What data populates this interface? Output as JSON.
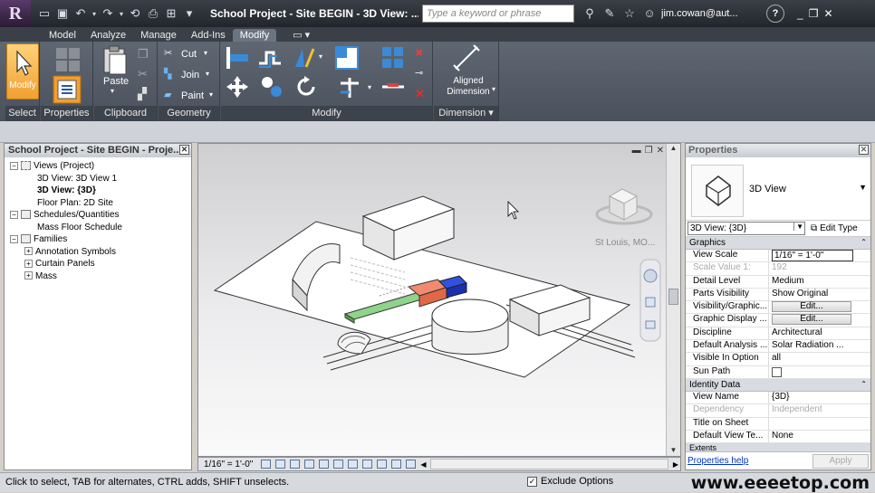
{
  "titlebar": {
    "app_letter": "R",
    "title": "School Project - Site BEGIN - 3D View: ...",
    "search_placeholder": "Type a keyword or phrase",
    "user": "jim.cowan@aut...",
    "help": "?"
  },
  "tabs": [
    "Model",
    "Analyze",
    "Manage",
    "Add-Ins",
    "Modify"
  ],
  "ribbon": {
    "modify_tool": "Modify",
    "paste": "Paste",
    "cut": "Cut",
    "join": "Join",
    "paint": "Paint",
    "aligned_dimension": "Aligned Dimension",
    "panels": [
      "Select",
      "Properties",
      "Clipboard",
      "Geometry",
      "Modify",
      "Dimension"
    ]
  },
  "browser": {
    "title": "School Project - Site BEGIN - Proje...",
    "items": [
      {
        "label": "Views (Project)",
        "level": 0,
        "expander": "−"
      },
      {
        "label": "3D View: 3D View 1",
        "level": 1
      },
      {
        "label": "3D View: {3D}",
        "level": 1,
        "bold": true
      },
      {
        "label": "Floor Plan: 2D Site",
        "level": 1
      },
      {
        "label": "Schedules/Quantities",
        "level": 0,
        "expander": "−"
      },
      {
        "label": "Mass Floor Schedule",
        "level": 1
      },
      {
        "label": "Families",
        "level": 0,
        "expander": "−"
      },
      {
        "label": "Annotation Symbols",
        "level": 1,
        "expander": "+"
      },
      {
        "label": "Curtain Panels",
        "level": 1,
        "expander": "+"
      },
      {
        "label": "Mass",
        "level": 1,
        "expander": "+"
      }
    ]
  },
  "viewport": {
    "location": "St Louis, MO...",
    "scale": "1/16\" = 1'-0\""
  },
  "properties": {
    "title": "Properties",
    "type_name": "3D View",
    "instance": "3D View: {3D}",
    "edit_type": "Edit Type",
    "groups": [
      {
        "name": "Graphics",
        "rows": [
          {
            "key": "View Scale",
            "value": "1/16\" = 1'-0\""
          },
          {
            "key": "Scale Value    1:",
            "value": "192",
            "disabled": true
          },
          {
            "key": "Detail Level",
            "value": "Medium"
          },
          {
            "key": "Parts Visibility",
            "value": "Show Original"
          },
          {
            "key": "Visibility/Graphic...",
            "value": "Edit..."
          },
          {
            "key": "Graphic Display ...",
            "value": "Edit..."
          },
          {
            "key": "Discipline",
            "value": "Architectural"
          },
          {
            "key": "Default Analysis ...",
            "value": "Solar Radiation ..."
          },
          {
            "key": "Visible In Option",
            "value": "all"
          },
          {
            "key": "Sun Path",
            "value": ""
          }
        ]
      },
      {
        "name": "Identity Data",
        "rows": [
          {
            "key": "View Name",
            "value": "{3D}"
          },
          {
            "key": "Dependency",
            "value": "Independent",
            "disabled": true
          },
          {
            "key": "Title on Sheet",
            "value": ""
          },
          {
            "key": "Default View Te...",
            "value": "None"
          }
        ]
      },
      {
        "name": "Extents",
        "rows": []
      }
    ],
    "help_link": "Properties help",
    "apply": "Apply"
  },
  "statusbar": {
    "text": "Click to select, TAB for alternates, CTRL adds, SHIFT unselects.",
    "exclude_options": "Exclude Options",
    "watermark": "www.eeeetop.com"
  }
}
